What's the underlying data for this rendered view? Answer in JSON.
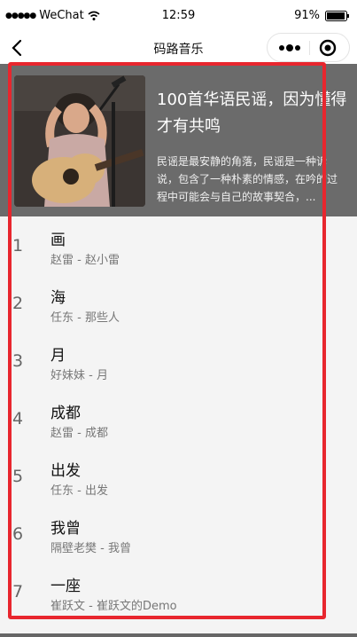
{
  "status_bar": {
    "carrier": "WeChat",
    "time": "12:59",
    "battery": "91%"
  },
  "nav": {
    "title": "码路音乐"
  },
  "playlist": {
    "title": "100首华语民谣，因为懂得才有共鸣",
    "description": "民谣是最安静的角落，民谣是一种诉说，包含了一种朴素的情感，在吟的过程中可能会与自己的故事契合，..."
  },
  "songs": [
    {
      "index": "1",
      "name": "画",
      "sub": "赵雷 - 赵小雷"
    },
    {
      "index": "2",
      "name": "海",
      "sub": "任东 - 那些人"
    },
    {
      "index": "3",
      "name": "月",
      "sub": "好妹妹 - 月"
    },
    {
      "index": "4",
      "name": "成都",
      "sub": "赵雷 - 成都"
    },
    {
      "index": "5",
      "name": "出发",
      "sub": "任东 - 出发"
    },
    {
      "index": "6",
      "name": "我曾",
      "sub": "隔壁老樊 - 我曾"
    },
    {
      "index": "7",
      "name": "一座",
      "sub": "崔跃文 - 崔跃文的Demo"
    }
  ],
  "colors": {
    "header_bg": "#6b6b6b",
    "highlight": "#e8262e"
  }
}
